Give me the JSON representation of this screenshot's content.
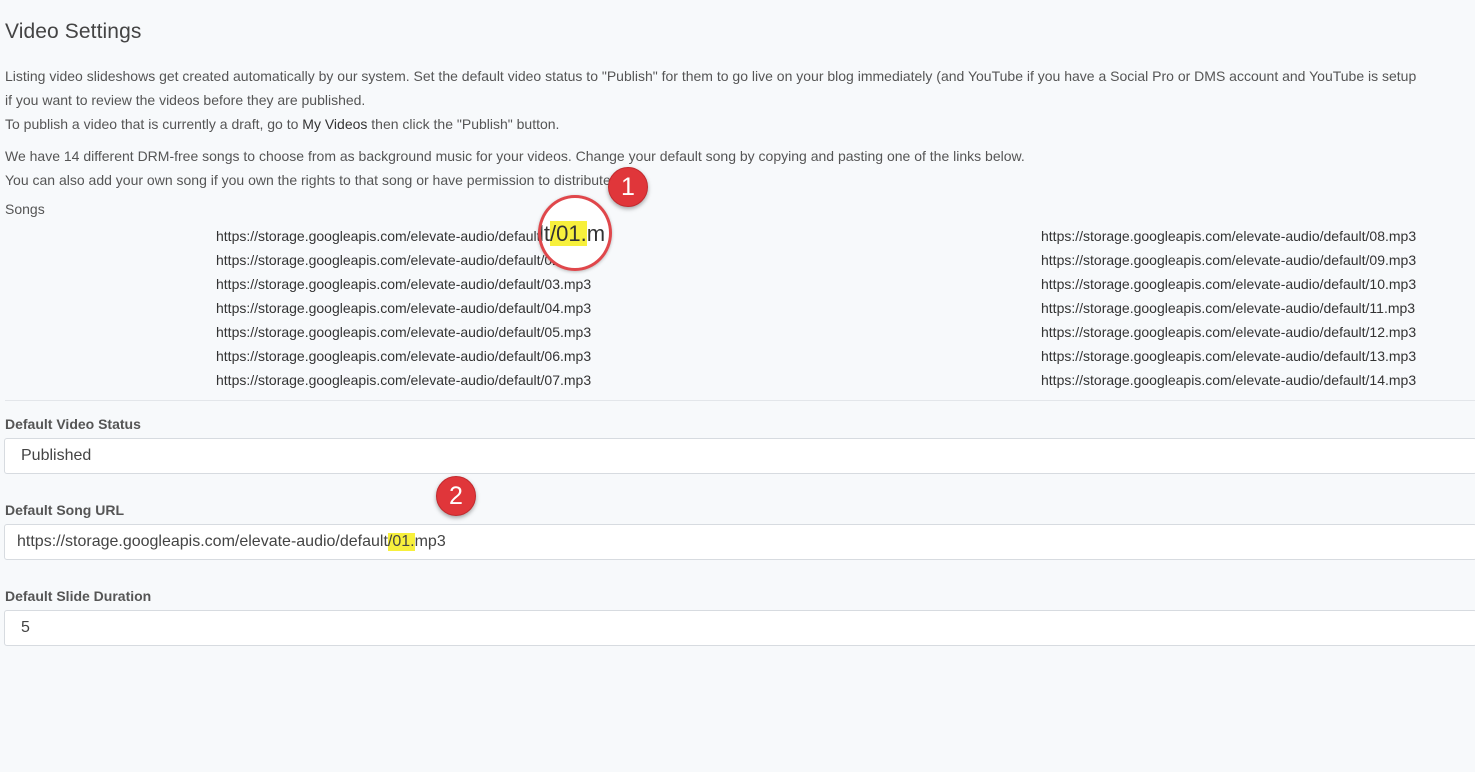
{
  "page": {
    "title": "Video Settings"
  },
  "intro": {
    "line1": "Listing video slideshows get created automatically by our system. Set the default video status to \"Publish\" for them to go live on your blog immediately (and YouTube if you have a Social Pro or DMS account and YouTube is setup",
    "line2": "if you want to review the videos before they are published.",
    "line3_prefix": "To publish a video that is currently a draft, go to ",
    "line3_link": "My Videos",
    "line3_suffix": " then click the \"Publish\" button."
  },
  "music_info": {
    "line1": "We have 14 different DRM-free songs to choose from as background music for your videos. Change your default song by copying and pasting one of the links below.",
    "line2": "You can also add your own song if you own the rights to that song or have permission to distribute it."
  },
  "songs": {
    "label": "Songs",
    "column_a": [
      "https://storage.googleapis.com/elevate-audio/default/01.mp3",
      "https://storage.googleapis.com/elevate-audio/default/02.mp3",
      "https://storage.googleapis.com/elevate-audio/default/03.mp3",
      "https://storage.googleapis.com/elevate-audio/default/04.mp3",
      "https://storage.googleapis.com/elevate-audio/default/05.mp3",
      "https://storage.googleapis.com/elevate-audio/default/06.mp3",
      "https://storage.googleapis.com/elevate-audio/default/07.mp3"
    ],
    "column_b": [
      "https://storage.googleapis.com/elevate-audio/default/08.mp3",
      "https://storage.googleapis.com/elevate-audio/default/09.mp3",
      "https://storage.googleapis.com/elevate-audio/default/10.mp3",
      "https://storage.googleapis.com/elevate-audio/default/11.mp3",
      "https://storage.googleapis.com/elevate-audio/default/12.mp3",
      "https://storage.googleapis.com/elevate-audio/default/13.mp3",
      "https://storage.googleapis.com/elevate-audio/default/14.mp3"
    ]
  },
  "fields": {
    "status": {
      "label": "Default Video Status",
      "value": "Published"
    },
    "song_url": {
      "label": "Default Song URL",
      "value_prefix": "https://storage.googleapis.com/elevate-audio/default",
      "value_highlight": "/01.",
      "value_suffix": "mp3"
    },
    "slide_duration": {
      "label": "Default Slide Duration",
      "value": "5"
    }
  },
  "annotations": {
    "badge_1": "1",
    "badge_2": "2",
    "zoom_prefix": "lt",
    "zoom_highlight": "/01.",
    "zoom_suffix": "m"
  },
  "colors": {
    "background": "#f7f9fb",
    "highlight": "#f7f03c",
    "badge": "#e0363a"
  }
}
